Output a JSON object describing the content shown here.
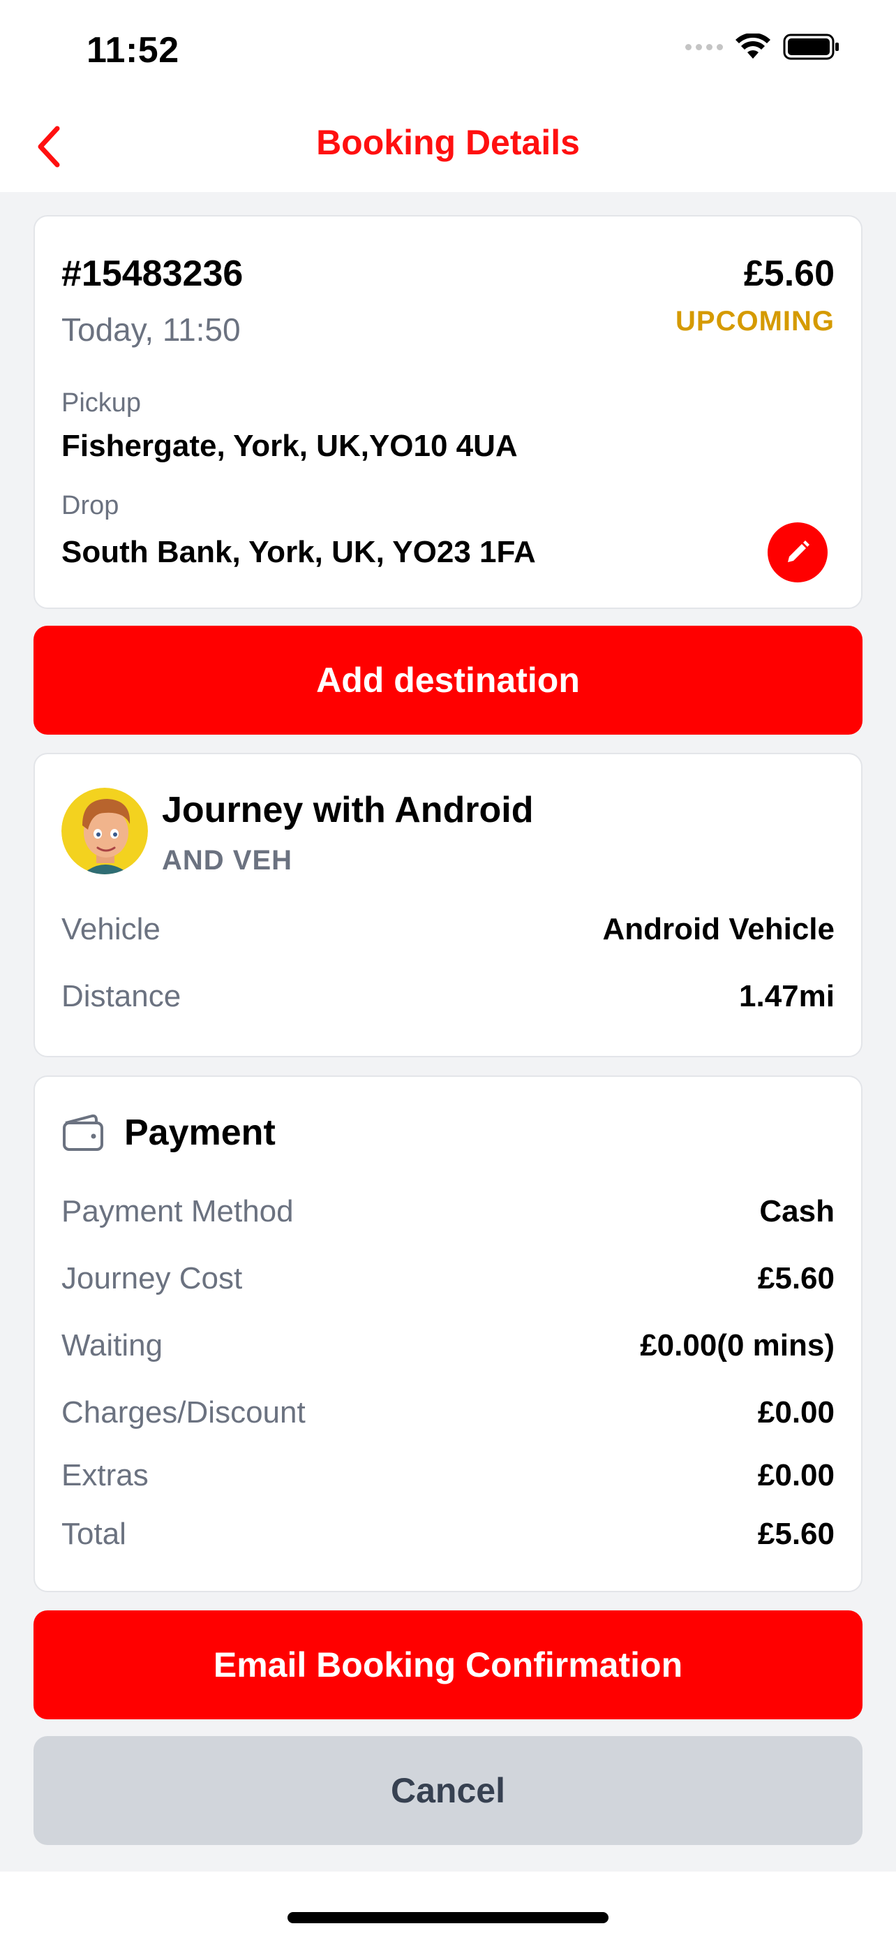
{
  "status_bar": {
    "time": "11:52"
  },
  "nav": {
    "title": "Booking Details"
  },
  "booking": {
    "id": "#15483236",
    "date": "Today, 11:50",
    "price": "£5.60",
    "status": "UPCOMING",
    "pickup_label": "Pickup",
    "pickup_value": "Fishergate, York, UK,YO10 4UA",
    "drop_label": "Drop",
    "drop_value": "South Bank, York, UK, YO23 1FA"
  },
  "add_destination_label": "Add destination",
  "journey": {
    "title": "Journey with Android",
    "subtitle": "AND VEH",
    "rows": [
      {
        "label": "Vehicle",
        "value": "Android Vehicle"
      },
      {
        "label": "Distance",
        "value": "1.47mi"
      }
    ]
  },
  "payment": {
    "title": "Payment",
    "rows": [
      {
        "label": "Payment Method",
        "value": "Cash"
      },
      {
        "label": "Journey Cost",
        "value": "£5.60"
      },
      {
        "label": "Waiting",
        "value": "£0.00(0 mins)"
      },
      {
        "label": "Charges/Discount",
        "value": "£0.00"
      },
      {
        "label": "Extras",
        "value": "£0.00"
      },
      {
        "label": "Total",
        "value": "£5.60"
      }
    ]
  },
  "email_confirmation_label": "Email Booking Confirmation",
  "cancel_label": "Cancel",
  "colors": {
    "accent": "#ff0000",
    "status_upcoming": "#d59a00",
    "muted_text": "#6b7280"
  },
  "icons": [
    "back-chevron-icon",
    "pencil-icon",
    "wallet-icon",
    "wifi-icon",
    "battery-icon",
    "avatar"
  ]
}
